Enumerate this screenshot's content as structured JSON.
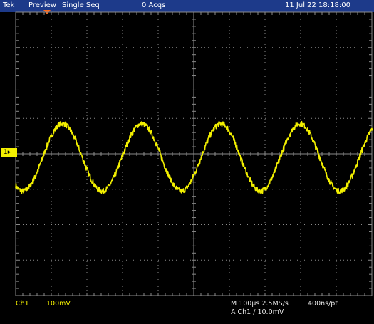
{
  "header": {
    "brand": "Tek",
    "mode": "Preview",
    "acq_mode": "Single Seq",
    "acq_count": "0 Acqs",
    "datetime": "11 Jul 22 18:18:00"
  },
  "channel_marker": {
    "label": "1",
    "arrow": "arrow-right-icon"
  },
  "footer": {
    "channel": "Ch1",
    "volts_per_div": "100mV",
    "timebase": "M 100µs 2.5MS/s",
    "record": "400ns/pt",
    "trigger": "A  Ch1  ∕  10.0mV"
  },
  "colors": {
    "trace": "#f3f000",
    "grid": "#8a8a8a",
    "topbar": "#1d3a8a",
    "trigger_marker": "#ff6a1a"
  },
  "waveform": {
    "periods_visible": 4.5,
    "amplitude_divisions": 0.95,
    "offset_divisions": -0.1,
    "noise": 0.07
  }
}
